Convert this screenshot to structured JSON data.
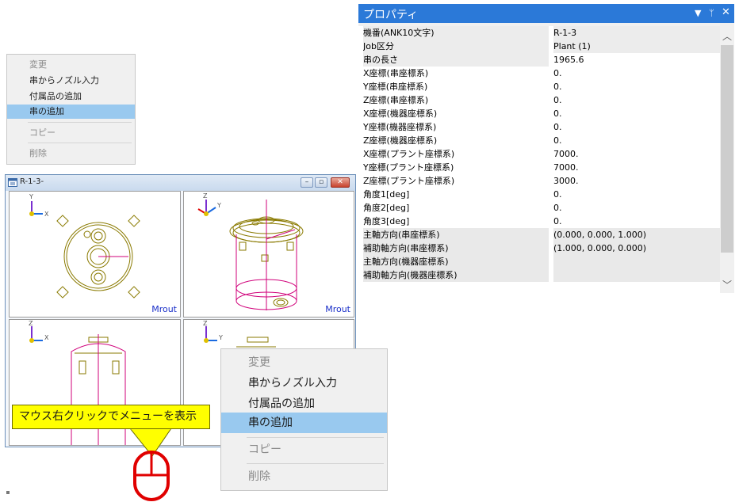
{
  "context_menu_small": {
    "items": [
      {
        "label": "変更",
        "state": "disabled"
      },
      {
        "label": "串からノズル入力",
        "state": "normal"
      },
      {
        "label": "付属品の追加",
        "state": "normal"
      },
      {
        "label": "串の追加",
        "state": "selected"
      },
      {
        "label": "コピー",
        "state": "disabled"
      },
      {
        "label": "削除",
        "state": "disabled"
      }
    ]
  },
  "context_menu_large": {
    "items": [
      {
        "label": "変更",
        "state": "disabled"
      },
      {
        "label": "串からノズル入力",
        "state": "normal"
      },
      {
        "label": "付属品の追加",
        "state": "normal"
      },
      {
        "label": "串の追加",
        "state": "selected"
      },
      {
        "label": "コピー",
        "state": "disabled"
      },
      {
        "label": "削除",
        "state": "disabled"
      }
    ]
  },
  "drawing_window": {
    "title": "R-1-3-",
    "viewports": [
      {
        "corner_label": "Mrout",
        "axes": [
          "Y",
          "X"
        ]
      },
      {
        "corner_label": "Mrout",
        "axes": [
          "Z",
          "Y"
        ]
      },
      {
        "corner_label": "",
        "axes": [
          "Z",
          "X"
        ]
      },
      {
        "corner_label": "",
        "axes": [
          "Z",
          "Y"
        ]
      }
    ]
  },
  "properties": {
    "title": "プロパティ",
    "icons": [
      "dropdown-icon",
      "pin-icon",
      "close-icon"
    ],
    "rows": [
      {
        "key": "機番(ANK10文字)",
        "value": "R-1-3"
      },
      {
        "key": "Job区分",
        "value": "Plant (1)"
      },
      {
        "key": "串の長さ",
        "value": "1965.6"
      },
      {
        "key": "X座標(串座標系)",
        "value": "0."
      },
      {
        "key": "Y座標(串座標系)",
        "value": "0."
      },
      {
        "key": "Z座標(串座標系)",
        "value": "0."
      },
      {
        "key": "X座標(機器座標系)",
        "value": "0."
      },
      {
        "key": "Y座標(機器座標系)",
        "value": "0."
      },
      {
        "key": "Z座標(機器座標系)",
        "value": "0."
      },
      {
        "key": "X座標(プラント座標系)",
        "value": "7000."
      },
      {
        "key": "Y座標(プラント座標系)",
        "value": "7000."
      },
      {
        "key": "Z座標(プラント座標系)",
        "value": "3000."
      },
      {
        "key": "角度1[deg]",
        "value": "0."
      },
      {
        "key": "角度2[deg]",
        "value": "0."
      },
      {
        "key": "角度3[deg]",
        "value": "0."
      },
      {
        "key": "主軸方向(串座標系)",
        "value": "(0.000, 0.000, 1.000)"
      },
      {
        "key": "補助軸方向(串座標系)",
        "value": "(1.000, 0.000, 0.000)"
      },
      {
        "key": "主軸方向(機器座標系)",
        "value": ""
      },
      {
        "key": "補助軸方向(機器座標系)",
        "value": ""
      }
    ]
  },
  "callout": {
    "text": "マウス右クリックでメニューを表示"
  },
  "colors": {
    "accent": "#2b79d8",
    "selection": "#99c9ef",
    "callout": "#ffff00",
    "mouse": "#e00000",
    "drawing": "#8a7a00",
    "drawing_alt": "#d0007a"
  }
}
